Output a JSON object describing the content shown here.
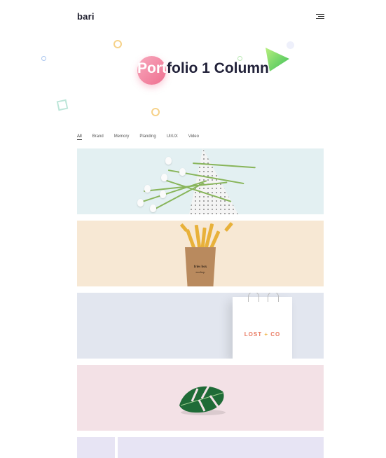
{
  "header": {
    "logo": "bari",
    "menu_icon": "hamburger-menu-icon"
  },
  "hero": {
    "title_highlight": "Port",
    "title_rest": "folio 1 Column"
  },
  "filters": [
    "All",
    "Brand",
    "Memory",
    "Planding",
    "UI/UX",
    "Video"
  ],
  "active_filter": "All",
  "cards": [
    {
      "image": "white-tulips-on-dotted-background",
      "background": "#e3f0f2"
    },
    {
      "image": "fries-box-mockup",
      "background": "#f7e8d4",
      "box_text": "fries box",
      "box_subtext": "mockup"
    },
    {
      "image": "shopping-bag-mockup",
      "background": "#e2e6ef",
      "bag_text": "LOST",
      "bag_plus": "+",
      "bag_text2": "CO"
    },
    {
      "image": "monstera-leaf",
      "background": "#f3e1e6"
    },
    {
      "image": "partial-card",
      "background": "#e7e4f4"
    }
  ],
  "colors": {
    "accent_pink": "#ef6e8f",
    "accent_green": "#6bd35f",
    "text_dark": "#22223a"
  }
}
